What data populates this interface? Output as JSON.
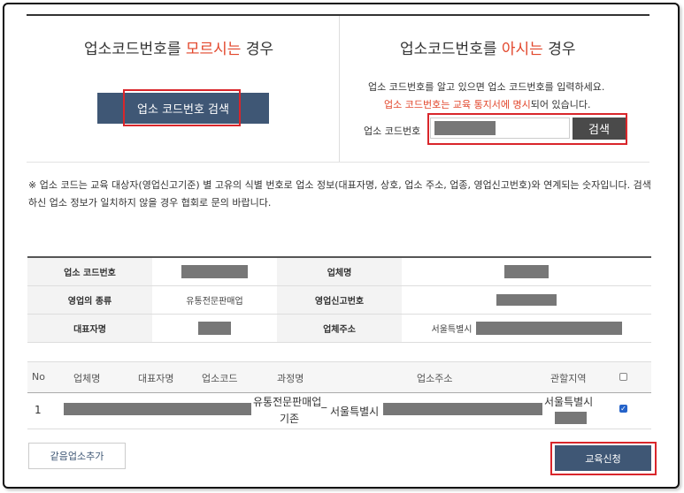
{
  "left_panel": {
    "title_pre": "업소코드번호를 ",
    "title_hl": "모르시는",
    "title_post": " 경우",
    "search_button": "업소 코드번호 검색"
  },
  "right_panel": {
    "title_pre": "업소코드번호를 ",
    "title_hl": "아시는",
    "title_post": " 경우",
    "desc1": "업소 코드번호를 알고 있으면 업소 코드번호를 입력하세요.",
    "desc2_hl": "업소 코드번호는 교육 통지서에 명시",
    "desc2_post": "되어 있습니다.",
    "code_label": "업소 코드번호",
    "search_button": "검색"
  },
  "notice": "※ 업소 코드는 교육 대상자(영업신고기준) 별 고유의 식별 번호로 업소 정보(대표자명, 상호, 업소 주소, 업종, 영업신고번호)와 연계되는 숫자입니다. 검색하신 업소 정보가 일치하지 않을 경우 협회로 문의 바랍니다.",
  "info_table": {
    "code_label": "업소 코드번호",
    "company_label": "업체명",
    "business_type_label": "영업의 종류",
    "business_type_value": "유통전문판매업",
    "report_no_label": "영업신고번호",
    "ceo_label": "대표자명",
    "address_label": "업체주소",
    "address_value": "서울특별시"
  },
  "list_table": {
    "headers": [
      "No",
      "업체명",
      "대표자명",
      "업소코드",
      "과정명",
      "업소주소",
      "관할지역"
    ],
    "rows": [
      {
        "no": "1",
        "course_line1": "유통전문판매업_",
        "course_line2": "기존",
        "address": "서울특별시",
        "region": "서울특별시"
      }
    ]
  },
  "buttons": {
    "add_same": "같음업소추가",
    "apply": "교육신청"
  },
  "colors": {
    "accent_navy": "#3f5775",
    "highlight_red": "#e2462b",
    "redact_gray": "#777777"
  }
}
